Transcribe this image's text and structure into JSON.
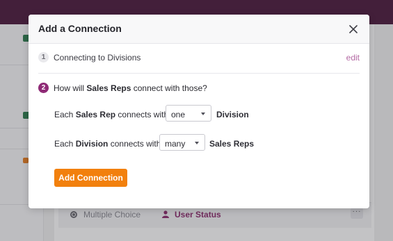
{
  "background": {
    "list_item_type": "Multiple Choice",
    "list_item_field": "User Status",
    "more_label": "···"
  },
  "modal": {
    "title": "Add a Connection",
    "step1": {
      "number": "1",
      "label": "Connecting to Divisions",
      "edit": "edit"
    },
    "step2": {
      "number": "2",
      "question_prefix": "How will",
      "question_subject": "Sales Reps",
      "question_suffix": "connect with those?"
    },
    "row1": {
      "prefix": "Each",
      "subject": "Sales Rep",
      "verb": "connects with",
      "selected": "one",
      "object": "Division"
    },
    "row2": {
      "prefix": "Each",
      "subject": "Division",
      "verb": "connects with",
      "selected": "many",
      "object": "Sales Reps"
    },
    "submit_label": "Add Connection"
  },
  "colors": {
    "topbar": "#4e1c3f",
    "accent": "#8f2a76",
    "button": "#f2800d",
    "edit_link": "#b46aa4"
  }
}
